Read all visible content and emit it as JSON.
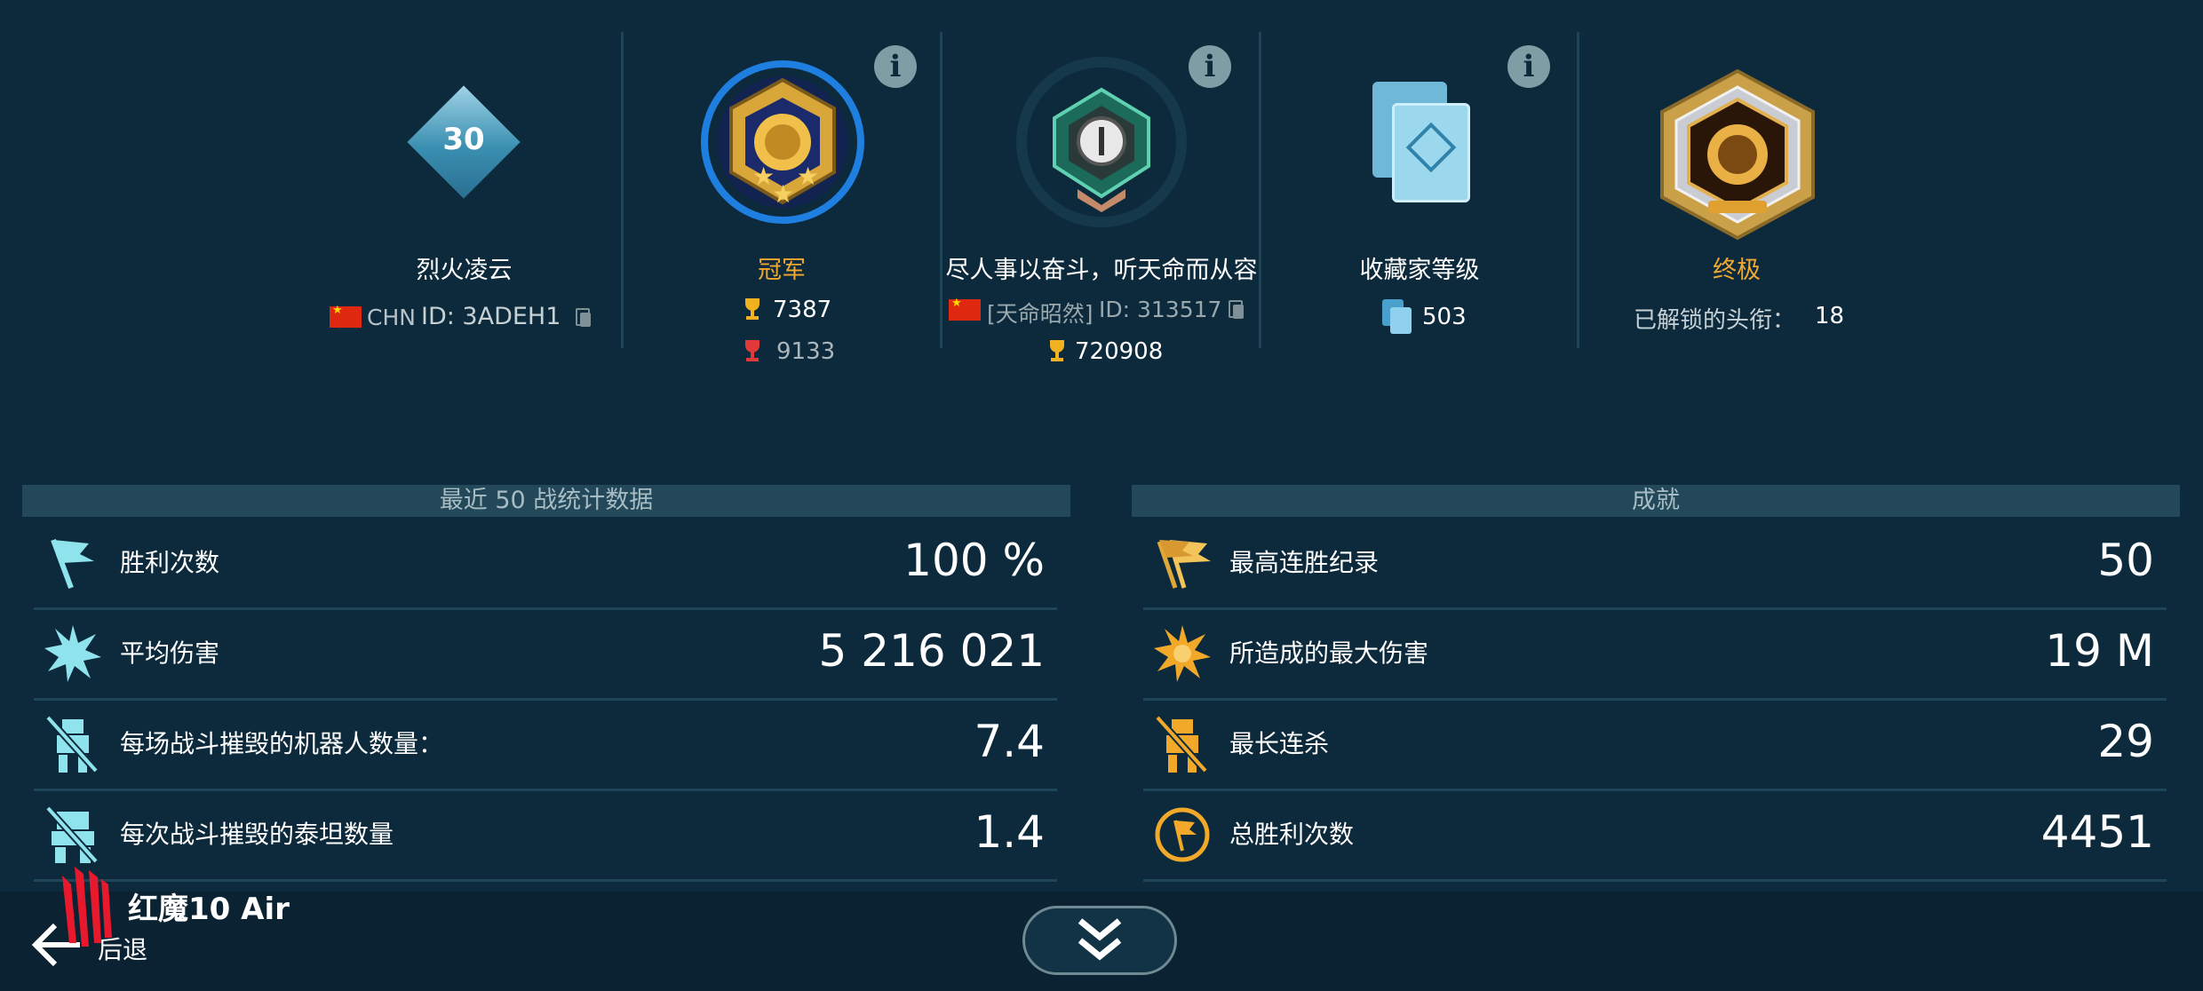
{
  "profile": {
    "player": {
      "level": "30",
      "name": "烈火凌云",
      "country": "CHN",
      "id": "ID: 3ADEH1"
    },
    "league": {
      "name": "冠军",
      "trophies": "7387",
      "max_trophies": "9133"
    },
    "clan": {
      "name": "尽人事以奋斗，听天命而从容",
      "tag": "[天命昭然]",
      "id": "ID: 313517",
      "trophies": "720908"
    },
    "collector": {
      "title": "收藏家等级",
      "value": "503"
    },
    "title_badge": {
      "name": "终极",
      "unlocked_label": "已解锁的头衔：",
      "unlocked_count": "18"
    }
  },
  "recent_stats": {
    "header": "最近 50 战统计数据",
    "rows": [
      {
        "label": "胜利次数",
        "value": "100 %",
        "icon": "flag-icon"
      },
      {
        "label": "平均伤害",
        "value": "5 216 021",
        "icon": "explosion-icon"
      },
      {
        "label": "每场战斗摧毁的机器人数量：",
        "value": "7.4",
        "icon": "robot-crossed-icon"
      },
      {
        "label": "每次战斗摧毁的泰坦数量",
        "value": "1.4",
        "icon": "titan-crossed-icon"
      }
    ]
  },
  "achievements": {
    "header": "成就",
    "rows": [
      {
        "label": "最高连胜纪录",
        "value": "50",
        "icon": "flags-icon"
      },
      {
        "label": "所造成的最大伤害",
        "value": "19 M",
        "icon": "explosion-icon"
      },
      {
        "label": "最长连杀",
        "value": "29",
        "icon": "robot-crossed-icon"
      },
      {
        "label": "总胜利次数",
        "value": "4451",
        "icon": "flag-circle-icon"
      }
    ]
  },
  "bottom": {
    "back_label": "后退",
    "device_watermark": "红魔10 Air",
    "expand_icon": "double-chevron-down-icon"
  },
  "colors": {
    "background": "#0c2a3c",
    "accent_gold": "#f0a830",
    "cyan": "#8fe3ec",
    "league_ring": "#1f7fe0"
  }
}
